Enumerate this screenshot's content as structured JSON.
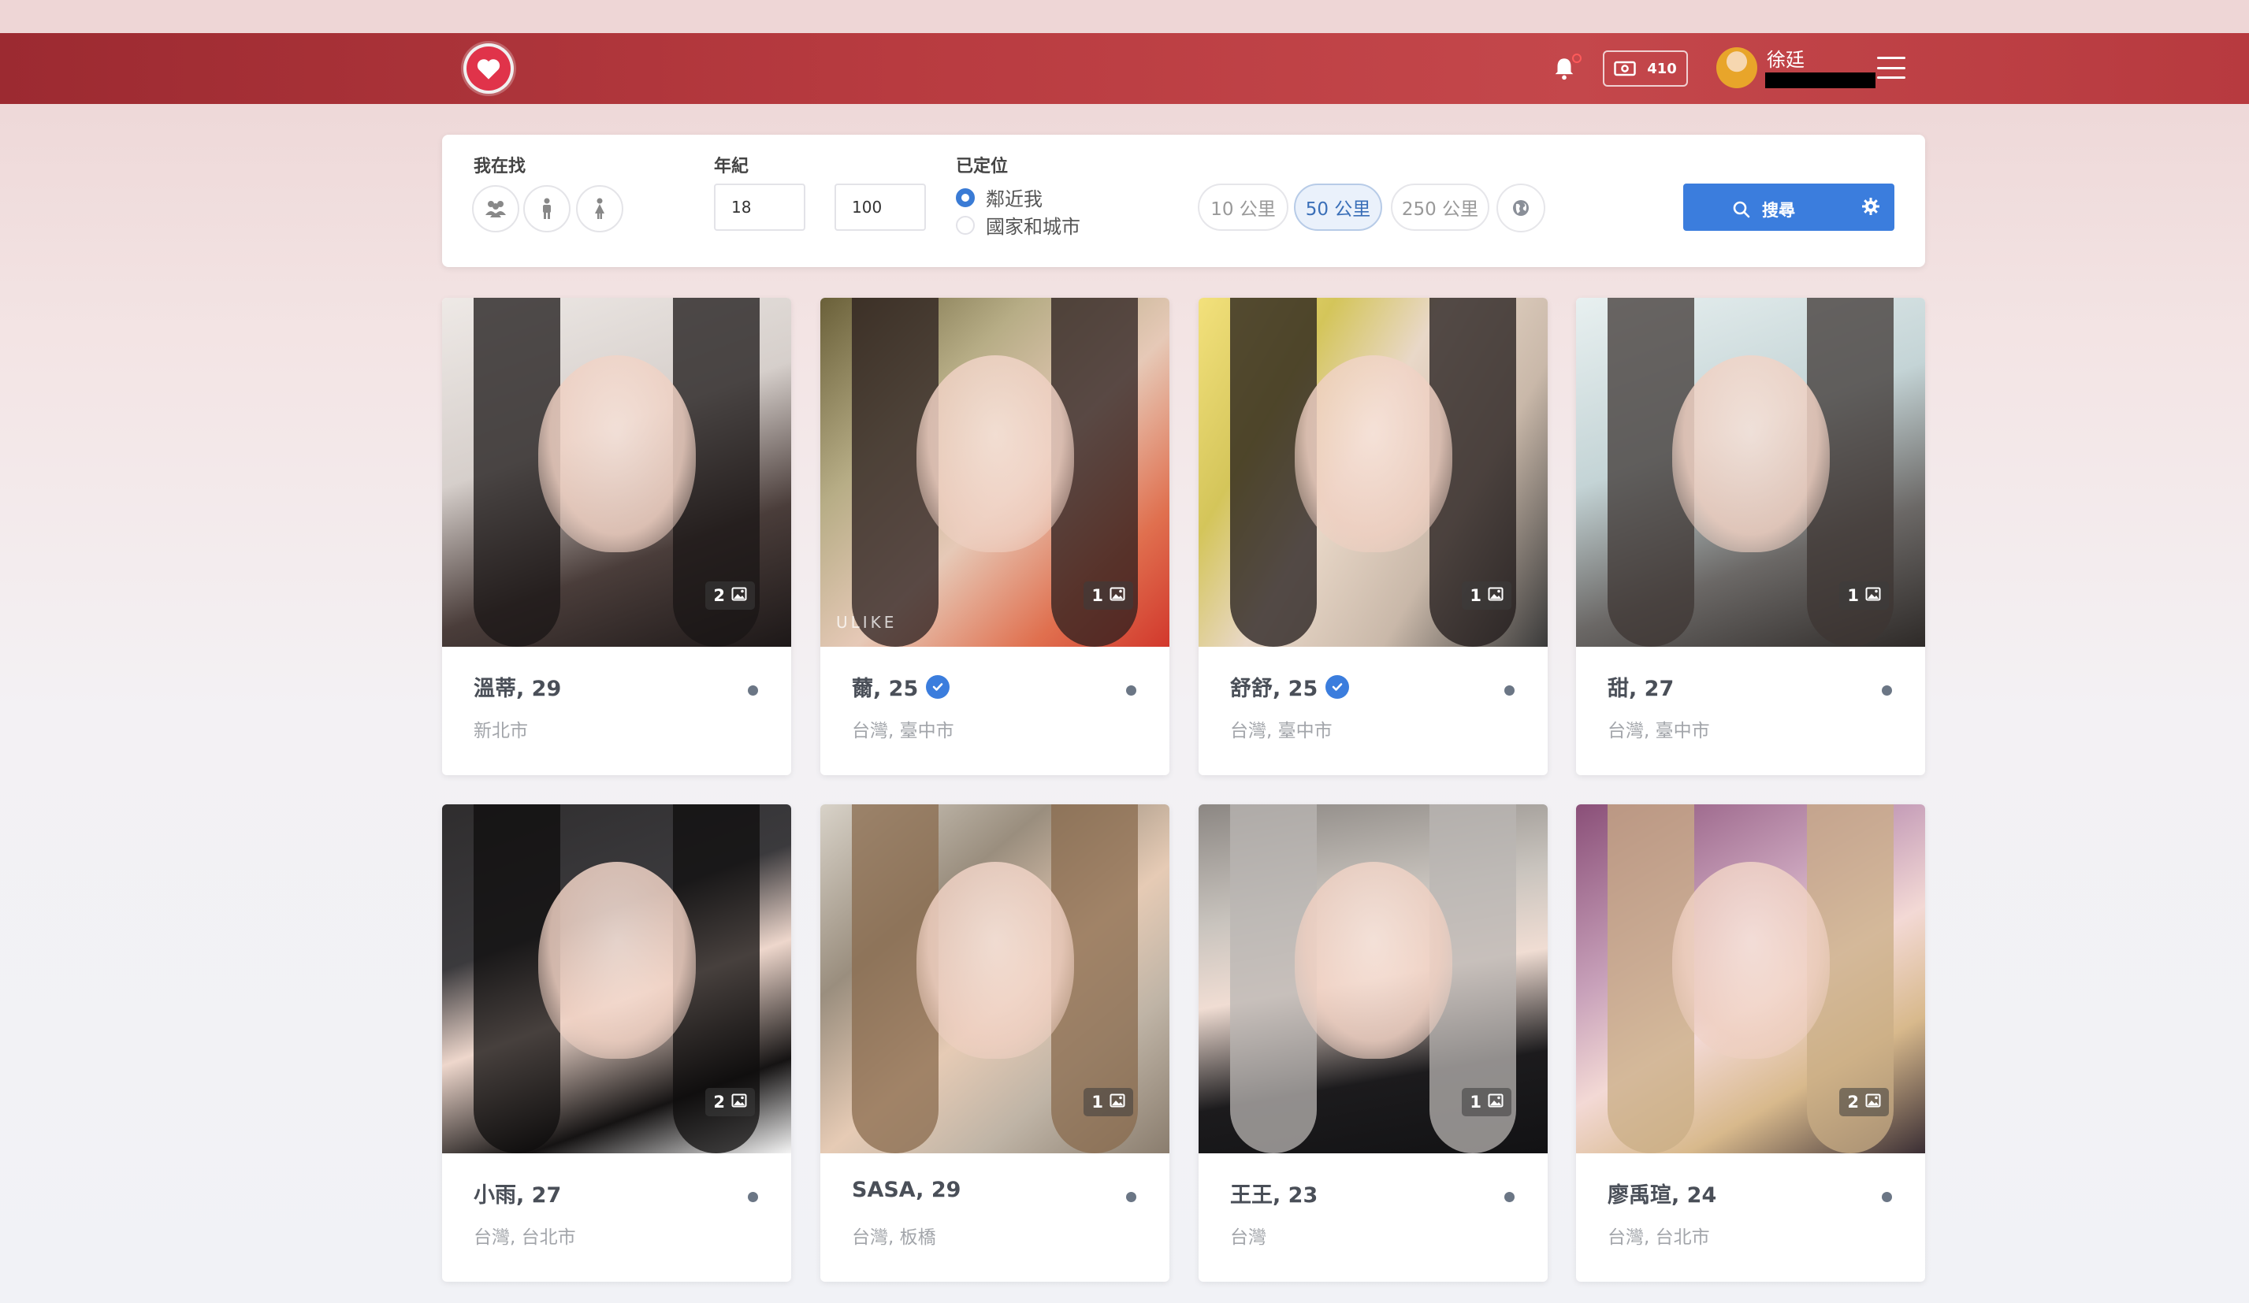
{
  "header": {
    "logo": "heart-logo",
    "credits": "410",
    "username": "徐廷"
  },
  "search": {
    "looking_for_label": "我在找",
    "age_label": "年紀",
    "age_min": "18",
    "age_max": "100",
    "location_label": "已定位",
    "location_options": [
      "鄰近我",
      "國家和城市"
    ],
    "location_selected": "鄰近我",
    "distances": [
      "10 公里",
      "50 公里",
      "250 公里"
    ],
    "distance_selected": "50 公里",
    "search_button": "搜尋"
  },
  "profiles": [
    {
      "name": "溫蒂, 29",
      "location": "新北市",
      "photos": "2",
      "verified": false
    },
    {
      "name": "薾, 25",
      "location": "台灣, 臺中市",
      "photos": "1",
      "verified": true
    },
    {
      "name": "舒舒, 25",
      "location": "台灣, 臺中市",
      "photos": "1",
      "verified": true
    },
    {
      "name": "甜, 27",
      "location": "台灣, 臺中市",
      "photos": "1",
      "verified": false
    },
    {
      "name": "小雨, 27",
      "location": "台灣, 台北市",
      "photos": "2",
      "verified": false
    },
    {
      "name": "SASA, 29",
      "location": "台灣, 板橋",
      "photos": "1",
      "verified": false
    },
    {
      "name": "王王, 23",
      "location": "台灣",
      "photos": "1",
      "verified": false
    },
    {
      "name": "廖禹瑄, 24",
      "location": "台灣, 台北市",
      "photos": "2",
      "verified": false
    }
  ],
  "photo_watermark": "ULIKE",
  "colors": {
    "header": "#b83b40",
    "accent": "#3b7ddd",
    "logo": "#e0334a"
  }
}
